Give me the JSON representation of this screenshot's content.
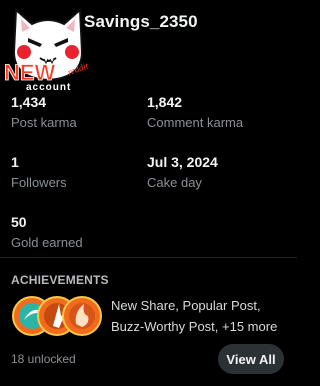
{
  "profile": {
    "username": "Savings_2350",
    "avatar_text": "NEW",
    "avatar_subtext": "account",
    "avatar_brand": "reddit"
  },
  "stats": [
    {
      "value": "1,434",
      "label": "Post karma"
    },
    {
      "value": "1,842",
      "label": "Comment karma"
    },
    {
      "value": "1",
      "label": "Followers"
    },
    {
      "value": "Jul 3, 2024",
      "label": "Cake day"
    },
    {
      "value": "50",
      "label": "Gold earned"
    }
  ],
  "achievements": {
    "title": "ACHIEVEMENTS",
    "summary_line1": "New Share, Popular Post,",
    "summary_line2": "Buzz-Worthy Post, +15 more",
    "unlocked_text": "18 unlocked",
    "view_all_label": "View All"
  },
  "colors": {
    "background": "#000000",
    "accent_red": "#ff3a1f",
    "badge_orange": "#f26b1d"
  }
}
